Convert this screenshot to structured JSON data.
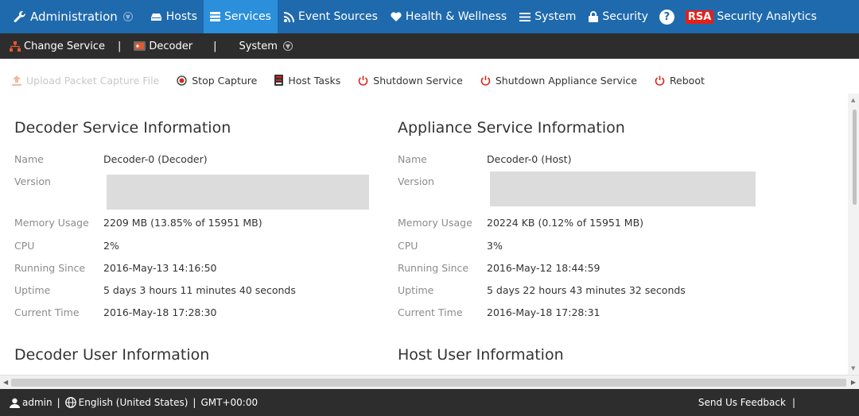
{
  "colors": {
    "nav_bg": "#1f6aad",
    "nav_active": "#2b8fdc",
    "subnav_bg": "#2d2d2d",
    "footer_bg": "#2d2d2d",
    "rsa_red": "#e3201b",
    "shutdown_red": "#d9261c"
  },
  "topnav": {
    "admin_label": "Administration",
    "items": [
      {
        "label": "Hosts",
        "icon": "hosts-icon"
      },
      {
        "label": "Services",
        "icon": "services-icon",
        "active": true
      },
      {
        "label": "Event Sources",
        "icon": "rss-icon"
      },
      {
        "label": "Health & Wellness",
        "icon": "heart-icon"
      },
      {
        "label": "System",
        "icon": "list-icon"
      },
      {
        "label": "Security",
        "icon": "lock-icon"
      }
    ],
    "help_glyph": "?",
    "brand_logo": "RSA",
    "product_name": "Security Analytics"
  },
  "subnav": {
    "change_service": "Change Service",
    "decoder": "Decoder",
    "separator": "|",
    "system": "System"
  },
  "toolbar": {
    "upload": "Upload Packet Capture File",
    "stop_capture": "Stop Capture",
    "host_tasks": "Host Tasks",
    "shutdown_service": "Shutdown Service",
    "shutdown_appliance": "Shutdown Appliance Service",
    "reboot": "Reboot"
  },
  "decoder_info": {
    "title": "Decoder Service Information",
    "name_label": "Name",
    "name_value": "Decoder-0 (Decoder)",
    "version_label": "Version",
    "memory_label": "Memory Usage",
    "memory_value": "2209 MB (13.85% of 15951 MB)",
    "cpu_label": "CPU",
    "cpu_value": "2%",
    "running_label": "Running Since",
    "running_value": "2016-May-13 14:16:50",
    "uptime_label": "Uptime",
    "uptime_value": "5 days 3 hours 11 minutes 40 seconds",
    "time_label": "Current Time",
    "time_value": "2016-May-18 17:28:30"
  },
  "appliance_info": {
    "title": "Appliance Service Information",
    "name_label": "Name",
    "name_value": "Decoder-0 (Host)",
    "version_label": "Version",
    "memory_label": "Memory Usage",
    "memory_value": "20224 KB (0.12% of 15951 MB)",
    "cpu_label": "CPU",
    "cpu_value": "3%",
    "running_label": "Running Since",
    "running_value": "2016-May-12 18:44:59",
    "uptime_label": "Uptime",
    "uptime_value": "5 days 22 hours 43 minutes 32 seconds",
    "time_label": "Current Time",
    "time_value": "2016-May-18 17:28:31"
  },
  "decoder_user_title": "Decoder User Information",
  "host_user_title": "Host User Information",
  "footer": {
    "user": "admin",
    "separator": "|",
    "language": "English (United States)",
    "timezone": "GMT+00:00",
    "feedback": "Send Us Feedback"
  }
}
